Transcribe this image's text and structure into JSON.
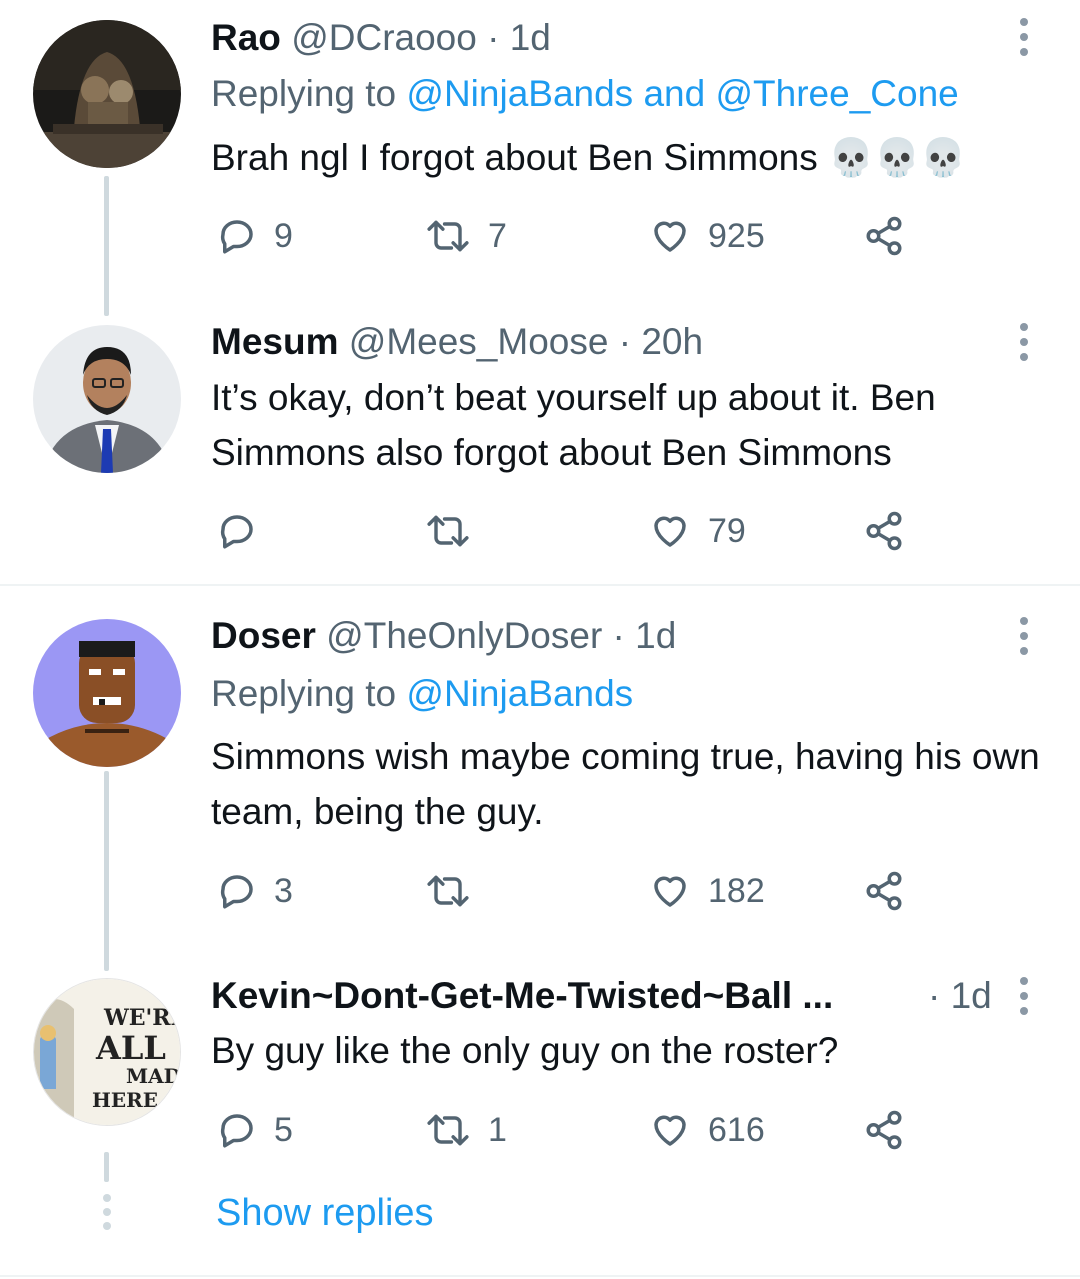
{
  "tweets": [
    {
      "name": "Rao",
      "handle": "@DCraooo",
      "separator": "·",
      "time": "1d",
      "replying_prefix": "Replying to ",
      "mention1": "@NinjaBands",
      "and_text": " and ",
      "mention2": "@Three_Cone",
      "text": "Brah ngl I forgot about Ben Simmons",
      "emoji": "💀💀💀",
      "replies": "9",
      "retweets": "7",
      "likes": "925"
    },
    {
      "name": "Mesum",
      "handle": "@Mees_Moose",
      "separator": "·",
      "time": "20h",
      "text": "It’s okay, don’t beat yourself up about it. Ben Simmons also forgot about Ben Simmons",
      "replies": "",
      "retweets": "",
      "likes": "79"
    },
    {
      "name": "Doser",
      "handle": "@TheOnlyDoser",
      "separator": "·",
      "time": "1d",
      "replying_prefix": "Replying to ",
      "mention1": "@NinjaBands",
      "text": "Simmons wish maybe coming true, having his own team, being the guy.",
      "replies": "3",
      "retweets": "",
      "likes": "182"
    },
    {
      "name": "Kevin~Dont-Get-Me-Twisted~Ball ...",
      "separator": "·",
      "time": "1d",
      "text": "By guy like the only guy on the roster?",
      "replies": "5",
      "retweets": "1",
      "likes": "616",
      "avatar_text": [
        "WE'RE",
        "ALL",
        "MAD",
        "HERE"
      ]
    }
  ],
  "show_replies": "Show replies",
  "colors": {
    "accent": "#1d9bf0",
    "secondary_text": "#536471",
    "thread_line": "#cfd9de"
  },
  "icons": [
    "reply-icon",
    "retweet-icon",
    "like-icon",
    "share-icon",
    "more-options-icon"
  ]
}
